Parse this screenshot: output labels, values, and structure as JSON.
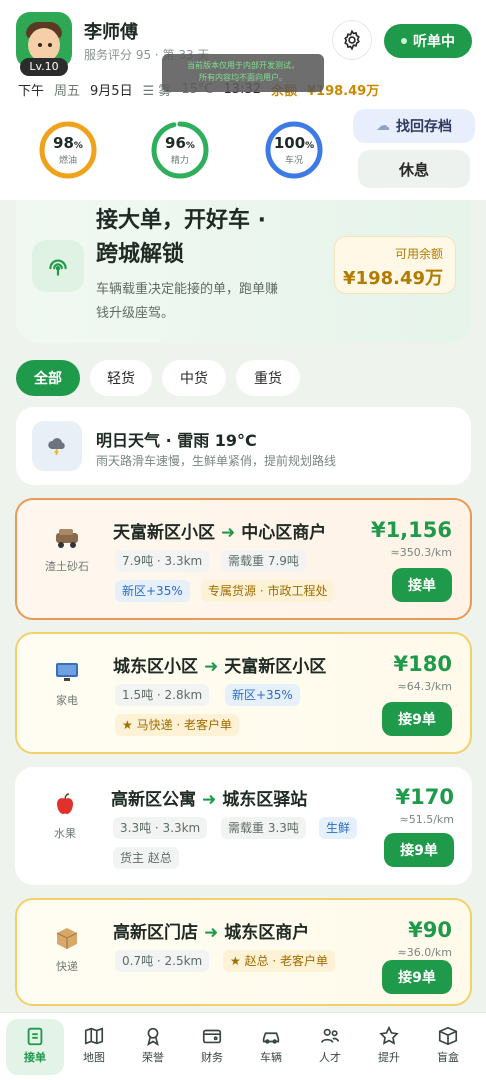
{
  "profile": {
    "name": "李师傅",
    "level": "Lv.10",
    "subtitle": "服务评分 95 · 第 33 天"
  },
  "header": {
    "listen_label": "听单中",
    "toast_line1": "当前版本仅用于内部开发测试，",
    "toast_line2": "所有内容均不面向用户。"
  },
  "status": {
    "period": "下午",
    "weekday": "周五",
    "date": "9月5日",
    "weather": "☰ 雾",
    "temp": "15°C",
    "time": "13:32",
    "balance_label": "余额",
    "balance_value": "¥198.49万"
  },
  "gauges": [
    {
      "value": "98",
      "unit": "%",
      "label": "燃油",
      "pct": 98,
      "color": "#f0a21a"
    },
    {
      "value": "96",
      "unit": "%",
      "label": "精力",
      "pct": 96,
      "color": "#2fae5b"
    },
    {
      "value": "100",
      "unit": "%",
      "label": "车况",
      "pct": 100,
      "color": "#3d7ae6"
    }
  ],
  "actions": {
    "recover_label": "找回存档",
    "rest_label": "休息"
  },
  "hero": {
    "title_line1": "接大单，开好车 ·",
    "title_line2": "跨城解锁",
    "desc_line1": "车辆载重决定能接的单，跑单赚",
    "desc_line2": "钱升级座驾。",
    "balance_label": "可用余额",
    "balance_value": "¥198.49万"
  },
  "filters": [
    "全部",
    "轻货",
    "中货",
    "重货"
  ],
  "weather_card": {
    "title": "明日天气 · 雷雨 19°C",
    "desc": "雨天路滑车速慢，生鲜单紧俏，提前规划路线"
  },
  "orders": [
    {
      "category": "渣土砂石",
      "from": "天富新区小区",
      "to": "中心区商户",
      "tags": [
        "7.9吨 · 3.3km",
        "需载重 7.9吨"
      ],
      "tags2": [
        "新区+35%",
        "专属货源 · 市政工程处"
      ],
      "price": "¥1,156",
      "per": "≈350.3/km",
      "accept": "接单"
    },
    {
      "category": "家电",
      "from": "城东区小区",
      "to": "天富新区小区",
      "tags": [
        "1.5吨 · 2.8km",
        "新区+35%"
      ],
      "tags2": [
        "★ 马快递 · 老客户单"
      ],
      "price": "¥180",
      "per": "≈64.3/km",
      "accept": "接9单"
    },
    {
      "category": "水果",
      "from": "高新区公寓",
      "to": "城东区驿站",
      "tags": [
        "3.3吨 · 3.3km",
        "需载重 3.3吨",
        "生鲜"
      ],
      "tags2": [
        "货主 赵总"
      ],
      "price": "¥170",
      "per": "≈51.5/km",
      "accept": "接9单"
    },
    {
      "category": "快递",
      "from": "高新区门店",
      "to": "城东区商户",
      "tags": [
        "0.7吨 · 2.5km",
        "★ 赵总 · 老客户单"
      ],
      "tags2": [],
      "price": "¥90",
      "per": "≈36.0/km",
      "accept": "接9单"
    }
  ],
  "tabbar": [
    "接单",
    "地图",
    "荣誉",
    "财务",
    "车辆",
    "人才",
    "提升",
    "盲盒"
  ],
  "colors": {
    "accent": "#1f9a4b",
    "gold": "#c98a00"
  }
}
